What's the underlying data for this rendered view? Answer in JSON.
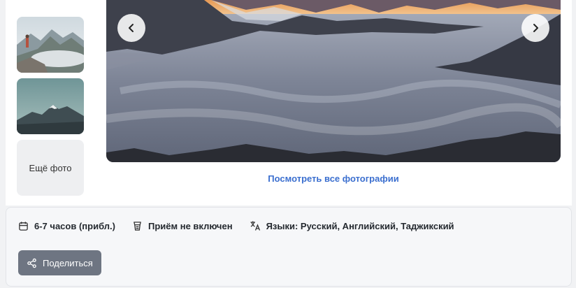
{
  "gallery": {
    "more_photos_label": "Ещё фото",
    "view_all_label": "Посмотреть все фотографии",
    "prev_icon": "chevron-left-icon",
    "next_icon": "chevron-right-icon"
  },
  "details": {
    "duration": "6-7 часов (прибл.)",
    "meal": "Приём не включен",
    "languages": "Языки: Русский, Английский, Таджикский"
  },
  "share": {
    "label": "Поделиться",
    "icon": "share-icon"
  },
  "colors": {
    "link": "#3b6fcf",
    "share_button_bg": "#6e7582"
  }
}
